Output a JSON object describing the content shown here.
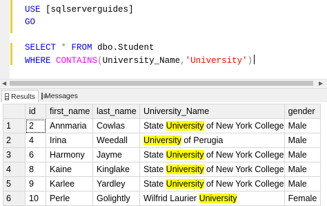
{
  "editor": {
    "line1": {
      "kw": "USE",
      "rest": " [sqlserverguides]"
    },
    "line2": {
      "kw": "GO"
    },
    "line3": {
      "kw": "SELECT",
      "star": " * ",
      "kw2": "FROM",
      "rest": " dbo.Student"
    },
    "line4": {
      "kw": "WHERE",
      "fn": "CONTAINS",
      "open": "(",
      "col": "University_Name",
      "comma": ",",
      "str": "'University'",
      "close": ")"
    }
  },
  "tabs": {
    "results_label": "Results",
    "messages_label": "Messages"
  },
  "grid": {
    "headers": [
      "id",
      "first_name",
      "last_name",
      "University_Name",
      "gender"
    ],
    "rows": [
      {
        "rownum": "1",
        "id": "2",
        "first_name": "Annmaria",
        "last_name": "Cowlas",
        "uni_pre": "State ",
        "uni_hl": "University",
        "uni_post": " of New York College",
        "gender": "Male"
      },
      {
        "rownum": "2",
        "id": "4",
        "first_name": "Irina",
        "last_name": "Weedall",
        "uni_pre": "",
        "uni_hl": "University",
        "uni_post": " of Perugia",
        "gender": "Male"
      },
      {
        "rownum": "3",
        "id": "6",
        "first_name": "Harmony",
        "last_name": "Jayme",
        "uni_pre": "State ",
        "uni_hl": "University",
        "uni_post": " of New York College",
        "gender": "Male"
      },
      {
        "rownum": "4",
        "id": "8",
        "first_name": "Kaine",
        "last_name": "Kinglake",
        "uni_pre": "State ",
        "uni_hl": "University",
        "uni_post": " of New York College",
        "gender": "Male"
      },
      {
        "rownum": "5",
        "id": "9",
        "first_name": "Karlee",
        "last_name": "Yardley",
        "uni_pre": "State ",
        "uni_hl": "University",
        "uni_post": " of New York College",
        "gender": "Male"
      },
      {
        "rownum": "6",
        "id": "10",
        "first_name": "Perle",
        "last_name": "Golightly",
        "uni_pre": "Wilfrid Laurier ",
        "uni_hl": "University",
        "uni_post": "",
        "gender": "Female"
      }
    ]
  },
  "colors": {
    "keyword": "#0000ff",
    "function": "#ff00ff",
    "string": "#ff0000",
    "highlight": "#ffff00"
  },
  "icons": {
    "results_tab": "grid-icon",
    "messages_tab": "messages-icon"
  }
}
